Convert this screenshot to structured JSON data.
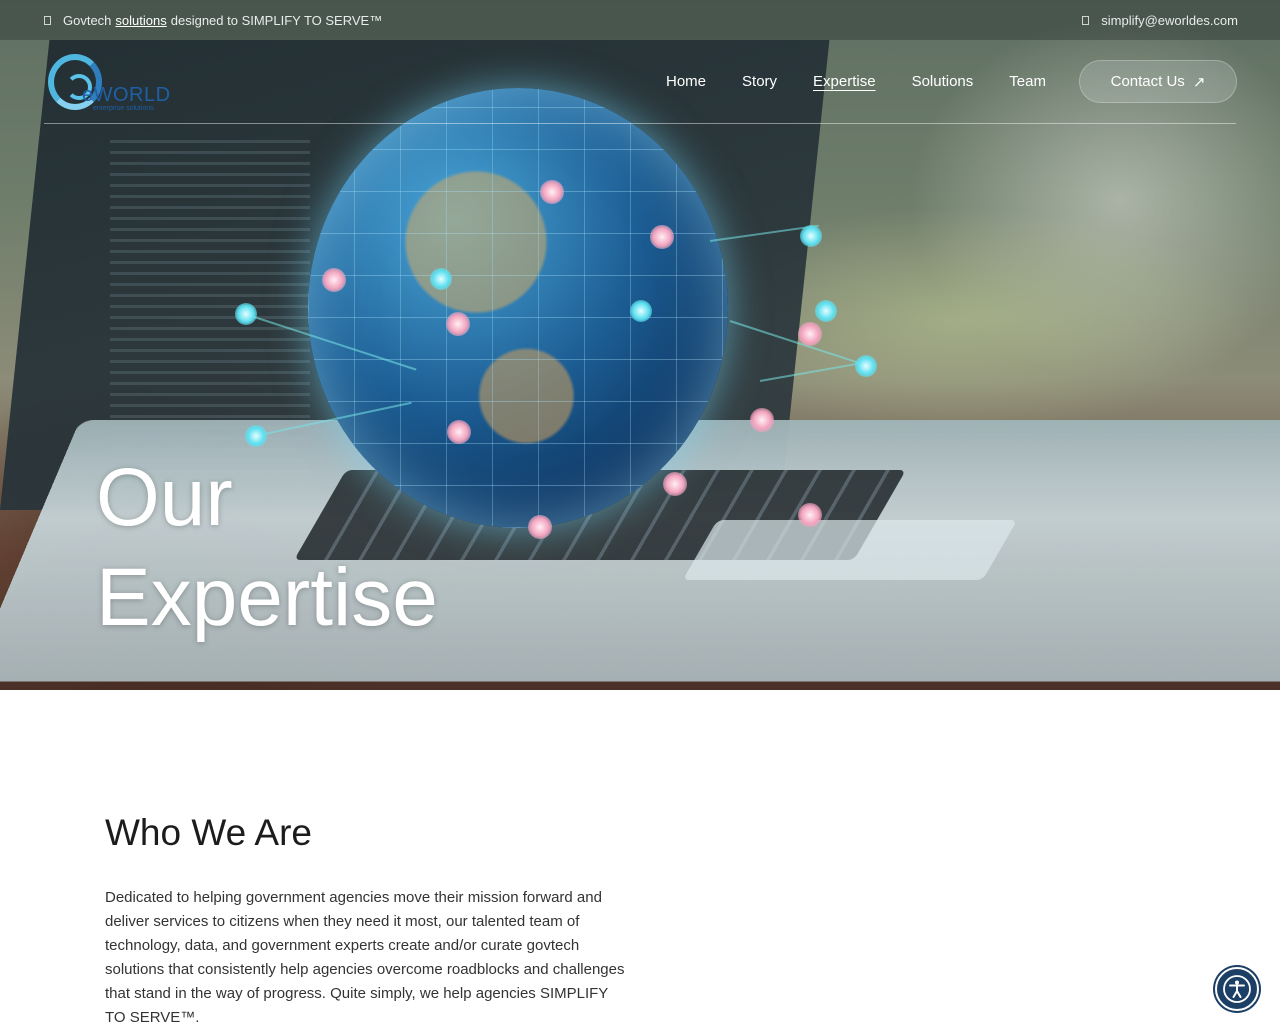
{
  "topbar": {
    "prefix": "Govtech",
    "link": "solutions",
    "suffix": "designed to SIMPLIFY TO SERVE™",
    "email": "simplify@eworldes.com",
    "location_icon": "map-pin-icon",
    "email_icon": "envelope-icon"
  },
  "logo": {
    "name": "eWORLD",
    "tagline": "enterprise solutions"
  },
  "nav": {
    "items": [
      {
        "label": "Home"
      },
      {
        "label": "Story"
      },
      {
        "label": "Expertise",
        "active": true
      },
      {
        "label": "Solutions"
      },
      {
        "label": "Team"
      }
    ],
    "contact_label": "Contact Us",
    "contact_icon": "arrow-up-right-icon"
  },
  "hero": {
    "title_line1": "Our",
    "title_line2": "Expertise"
  },
  "about": {
    "title": "Who We Are",
    "body": "Dedicated to helping government agencies move their mission forward and deliver services to citizens when they need it most, our talented team of technology, data, and government experts create and/or curate govtech solutions that consistently help agencies overcome roadblocks and challenges that stand in the way of progress. Quite simply, we help agencies SIMPLIFY TO SERVE™."
  },
  "accessibility": {
    "icon": "accessibility-icon"
  },
  "colors": {
    "brand_blue": "#1f5fa8",
    "logo_cyan": "#4fb6e0",
    "a11y_button": "#1c3f66"
  }
}
